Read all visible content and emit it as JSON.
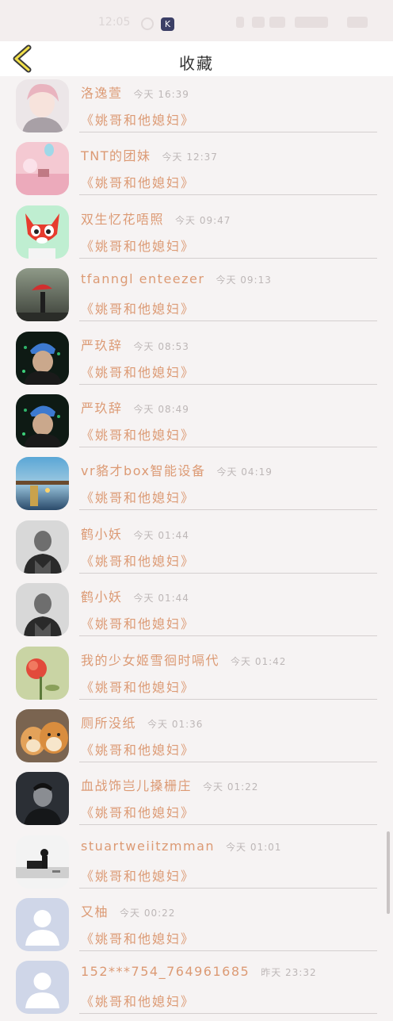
{
  "status_bar": {
    "time": "12:05",
    "k_badge": "K"
  },
  "header": {
    "title": "收藏"
  },
  "favorites": [
    {
      "name": "洛逸萱",
      "time": "今天 16:39",
      "title": "《姚哥和他媳妇》",
      "avatar": "anime-boy"
    },
    {
      "name": "TNT的团妹",
      "time": "今天 12:37",
      "title": "《姚哥和他媳妇》",
      "avatar": "pink-balloon"
    },
    {
      "name": "双生忆花唔照",
      "time": "今天 09:47",
      "title": "《姚哥和他媳妇》",
      "avatar": "red-fox-cartoon"
    },
    {
      "name": "tfanngl enteezer",
      "time": "今天 09:13",
      "title": "《姚哥和他媳妇》",
      "avatar": "umbrella-silhouette"
    },
    {
      "name": "严玖辞",
      "time": "今天 08:53",
      "title": "《姚哥和他媳妇》",
      "avatar": "blue-cap-portrait"
    },
    {
      "name": "严玖辞",
      "time": "今天 08:49",
      "title": "《姚哥和他媳妇》",
      "avatar": "blue-cap-portrait"
    },
    {
      "name": "vr貉才box智能设备",
      "time": "今天 04:19",
      "title": "《姚哥和他媳妇》",
      "avatar": "lake-pier"
    },
    {
      "name": "鹤小妖",
      "time": "今天 01:44",
      "title": "《姚哥和他媳妇》",
      "avatar": "bw-man-portrait"
    },
    {
      "name": "鹤小妖",
      "time": "今天 01:44",
      "title": "《姚哥和他媳妇》",
      "avatar": "bw-man-portrait"
    },
    {
      "name": "我的少女姬雪徊时嗝代",
      "time": "今天 01:42",
      "title": "《姚哥和他媳妇》",
      "avatar": "red-flower"
    },
    {
      "name": "厕所没纸",
      "time": "今天 01:36",
      "title": "《姚哥和他媳妇》",
      "avatar": "shiba-dogs"
    },
    {
      "name": "血战饰岂儿搡栅庄",
      "time": "今天 01:22",
      "title": "《姚哥和他媳妇》",
      "avatar": "dark-man-portrait"
    },
    {
      "name": "stuartweiitzmman",
      "time": "今天 01:01",
      "title": "《姚哥和他媳妇》",
      "avatar": "sitting-silhouette"
    },
    {
      "name": "又柚",
      "time": "今天 00:22",
      "title": "《姚哥和他媳妇》",
      "avatar": "default-avatar"
    },
    {
      "name": "152***754_764961685",
      "time": "昨天 23:32",
      "title": "《姚哥和他媳妇》",
      "avatar": "default-avatar"
    }
  ]
}
